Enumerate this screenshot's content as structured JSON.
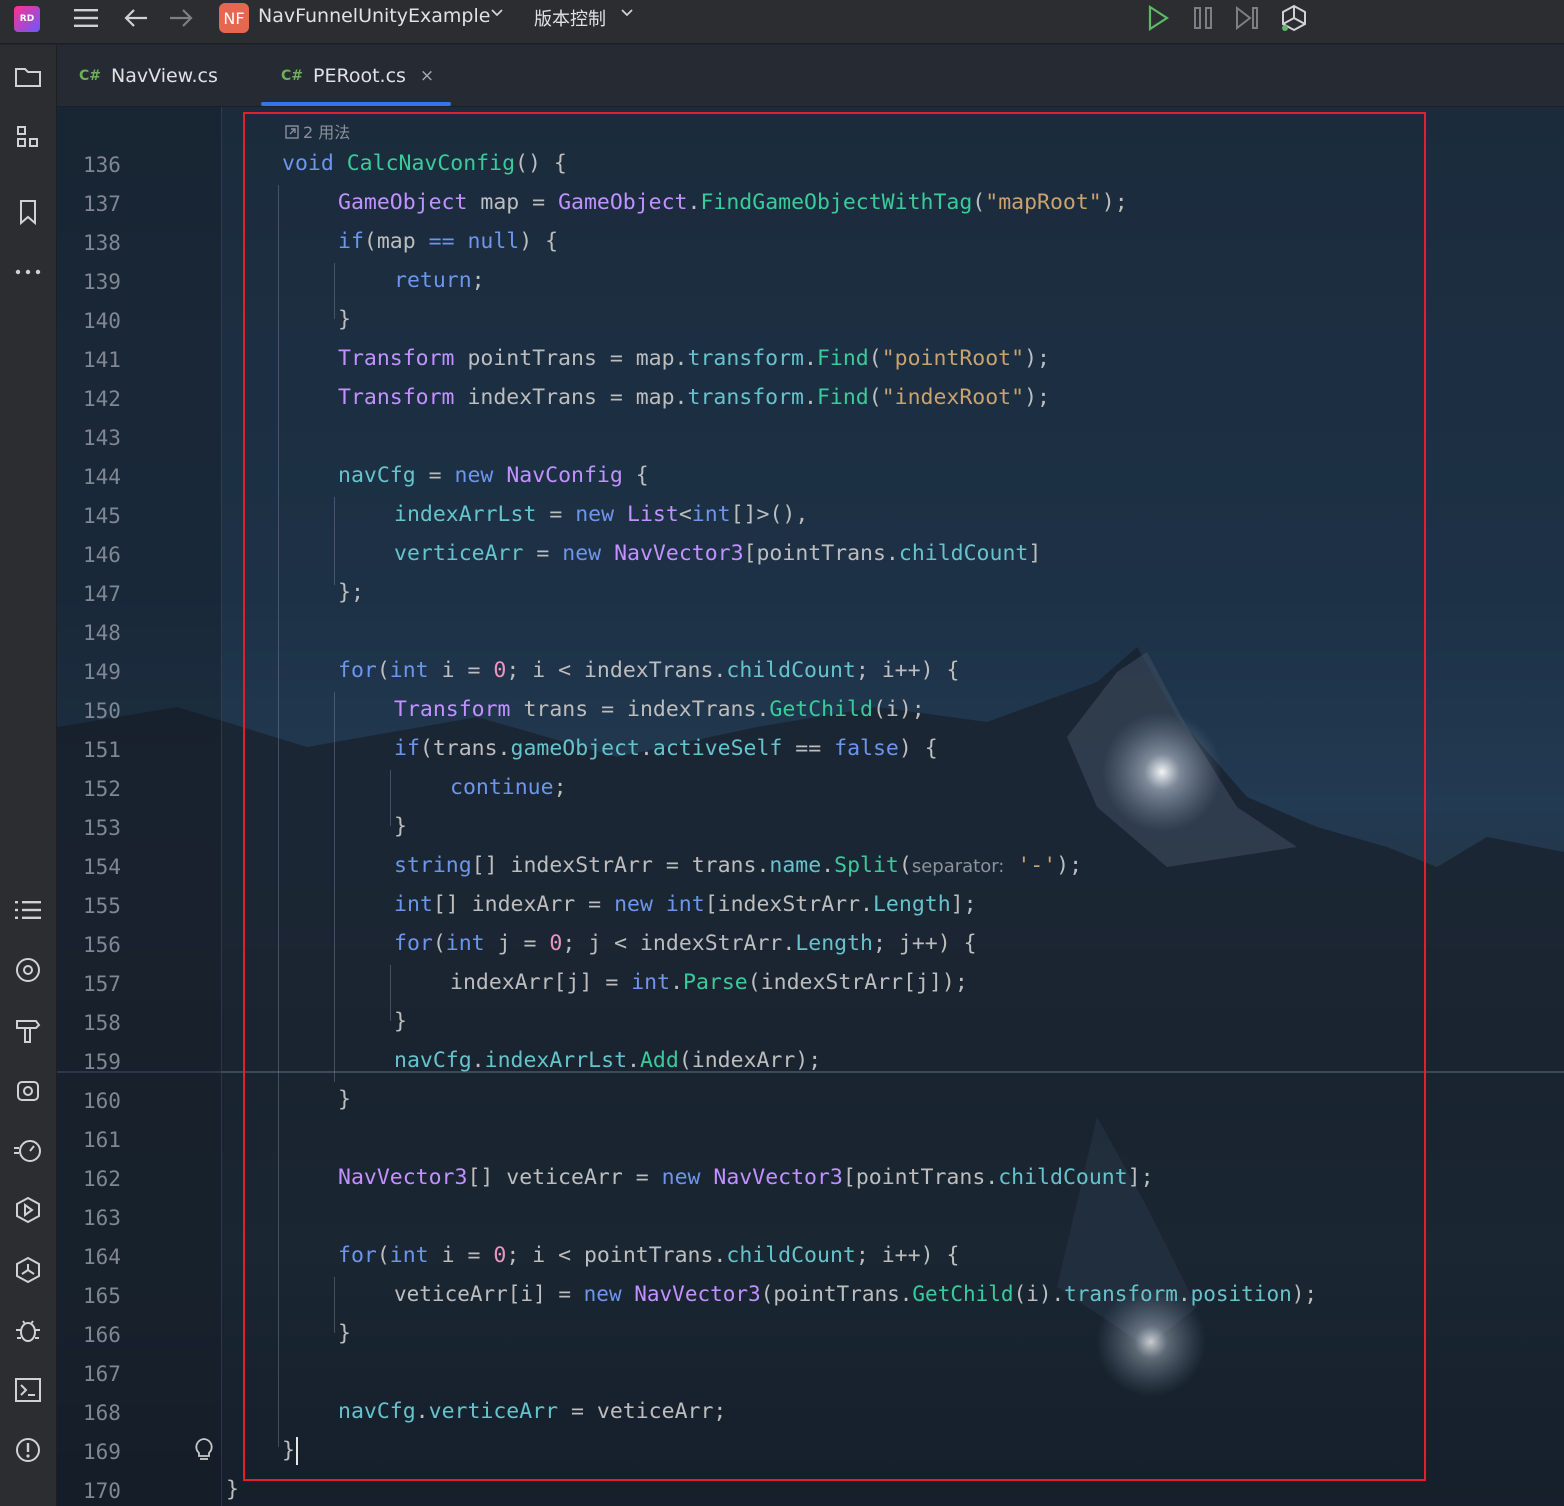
{
  "toolbar": {
    "logo": "RD",
    "project_badge": "NF",
    "project_name": "NavFunnelUnityExample",
    "version_control": "版本控制",
    "icons": [
      "menu-icon",
      "back-arrow-icon",
      "forward-arrow-icon",
      "run-icon",
      "pause-icon",
      "step-icon",
      "unity-icon"
    ]
  },
  "tabs": [
    {
      "lang": "C#",
      "label": "NavView.cs",
      "active": false
    },
    {
      "lang": "C#",
      "label": "PERoot.cs",
      "active": true,
      "close": "×"
    }
  ],
  "left_strip_icons": [
    "folder-icon",
    "structure-icon",
    "bookmark-icon",
    "more-icon",
    "list-icon",
    "git-icon",
    "build-icon",
    "unity-test-icon",
    "profiler-icon",
    "run-tool-icon",
    "unity-icon",
    "debug-icon",
    "terminal-icon",
    "problems-icon"
  ],
  "editor": {
    "usages": "2 用法",
    "line_numbers": [
      "136",
      "137",
      "138",
      "139",
      "140",
      "141",
      "142",
      "143",
      "144",
      "145",
      "146",
      "147",
      "148",
      "149",
      "150",
      "151",
      "152",
      "153",
      "154",
      "155",
      "156",
      "157",
      "158",
      "159",
      "160",
      "161",
      "162",
      "163",
      "164",
      "165",
      "166",
      "167",
      "168",
      "169",
      "170"
    ],
    "code": {
      "l136": [
        "void",
        " ",
        "CalcNavConfig",
        "() {"
      ],
      "l137": [
        "GameObject",
        " map = ",
        "GameObject",
        ".",
        "FindGameObjectWithTag",
        "(",
        "\"mapRoot\"",
        ");"
      ],
      "l138": [
        "if",
        "(map ",
        "==",
        " ",
        "null",
        ") {"
      ],
      "l139": [
        "return",
        ";"
      ],
      "l140": [
        "}"
      ],
      "l141": [
        "Transform",
        " pointTrans = map.",
        "transform",
        ".",
        "Find",
        "(",
        "\"pointRoot\"",
        ");"
      ],
      "l142": [
        "Transform",
        " indexTrans = map.",
        "transform",
        ".",
        "Find",
        "(",
        "\"indexRoot\"",
        ");"
      ],
      "l144": [
        "navCfg",
        " = ",
        "new",
        " ",
        "NavConfig",
        " {"
      ],
      "l145": [
        "indexArrLst",
        " = ",
        "new",
        " ",
        "List",
        "<",
        "int",
        "[]>(),"
      ],
      "l146": [
        "verticeArr",
        " = ",
        "new",
        " ",
        "NavVector3",
        "[pointTrans.",
        "childCount",
        "]"
      ],
      "l147": [
        "};"
      ],
      "l149": [
        "for",
        "(",
        "int",
        " i = ",
        "0",
        "; i < indexTrans.",
        "childCount",
        "; i++) {"
      ],
      "l150": [
        "Transform",
        " trans = indexTrans.",
        "GetChild",
        "(i);"
      ],
      "l151": [
        "if",
        "(trans.",
        "gameObject",
        ".",
        "activeSelf",
        " == ",
        "false",
        ") {"
      ],
      "l152": [
        "continue",
        ";"
      ],
      "l153": [
        "}"
      ],
      "l154": [
        "string",
        "[] indexStrArr = trans.",
        "name",
        ".",
        "Split",
        "(",
        "separator:",
        " ",
        "'-'",
        ");"
      ],
      "l155": [
        "int",
        "[] indexArr = ",
        "new",
        " ",
        "int",
        "[indexStrArr.",
        "Length",
        "];"
      ],
      "l156": [
        "for",
        "(",
        "int",
        " j = ",
        "0",
        "; j < indexStrArr.",
        "Length",
        "; j++) {"
      ],
      "l157": [
        "indexArr[j] = ",
        "int",
        ".",
        "Parse",
        "(indexStrArr[j]);"
      ],
      "l158": [
        "}"
      ],
      "l159": [
        "navCfg",
        ".",
        "indexArrLst",
        ".",
        "Add",
        "(indexArr);"
      ],
      "l160": [
        "}"
      ],
      "l162": [
        "NavVector3",
        "[] veticeArr = ",
        "new",
        " ",
        "NavVector3",
        "[pointTrans.",
        "childCount",
        "];"
      ],
      "l164": [
        "for",
        "(",
        "int",
        " i = ",
        "0",
        "; i < pointTrans.",
        "childCount",
        "; i++) {"
      ],
      "l165": [
        "veticeArr[i] = ",
        "new",
        " ",
        "NavVector3",
        "(pointTrans.",
        "GetChild",
        "(i).",
        "transform",
        ".",
        "position",
        ");"
      ],
      "l166": [
        "}"
      ],
      "l168": [
        "navCfg",
        ".",
        "verticeArr",
        " = veticeArr;"
      ],
      "l169": [
        "}"
      ],
      "l170": [
        "}"
      ]
    },
    "colors": {
      "keyword": "#6c95eb",
      "type": "#c191ff",
      "method": "#39cc9b",
      "field": "#66c3cc",
      "string": "#c9a26d",
      "number": "#ed94c0",
      "highlight_box": "#e0202a"
    }
  }
}
